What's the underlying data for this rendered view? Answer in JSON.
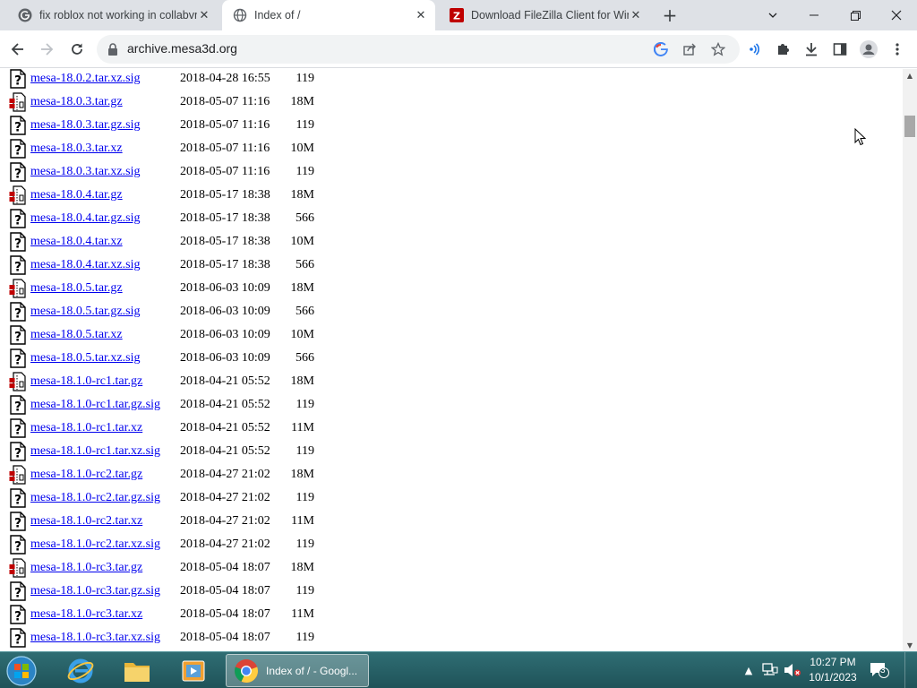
{
  "browser": {
    "tabs": [
      {
        "title": "fix roblox not working in collabvm",
        "favicon": "google-icon",
        "active": false
      },
      {
        "title": "Index of /",
        "favicon": "globe-icon",
        "active": true
      },
      {
        "title": "Download FileZilla Client for Windows",
        "favicon": "filezilla-icon",
        "active": false
      }
    ],
    "new_tab_label": "+",
    "url": "archive.mesa3d.org"
  },
  "listing": {
    "rows": [
      {
        "name": "mesa-18.0.2.tar.xz.sig",
        "date": "2018-04-28 16:55",
        "size": "119",
        "icon": "unknown-file-icon"
      },
      {
        "name": "mesa-18.0.3.tar.gz",
        "date": "2018-05-07 11:16",
        "size": "18M",
        "icon": "compressed-file-icon"
      },
      {
        "name": "mesa-18.0.3.tar.gz.sig",
        "date": "2018-05-07 11:16",
        "size": "119",
        "icon": "unknown-file-icon"
      },
      {
        "name": "mesa-18.0.3.tar.xz",
        "date": "2018-05-07 11:16",
        "size": "10M",
        "icon": "unknown-file-icon"
      },
      {
        "name": "mesa-18.0.3.tar.xz.sig",
        "date": "2018-05-07 11:16",
        "size": "119",
        "icon": "unknown-file-icon"
      },
      {
        "name": "mesa-18.0.4.tar.gz",
        "date": "2018-05-17 18:38",
        "size": "18M",
        "icon": "compressed-file-icon"
      },
      {
        "name": "mesa-18.0.4.tar.gz.sig",
        "date": "2018-05-17 18:38",
        "size": "566",
        "icon": "unknown-file-icon"
      },
      {
        "name": "mesa-18.0.4.tar.xz",
        "date": "2018-05-17 18:38",
        "size": "10M",
        "icon": "unknown-file-icon"
      },
      {
        "name": "mesa-18.0.4.tar.xz.sig",
        "date": "2018-05-17 18:38",
        "size": "566",
        "icon": "unknown-file-icon"
      },
      {
        "name": "mesa-18.0.5.tar.gz",
        "date": "2018-06-03 10:09",
        "size": "18M",
        "icon": "compressed-file-icon"
      },
      {
        "name": "mesa-18.0.5.tar.gz.sig",
        "date": "2018-06-03 10:09",
        "size": "566",
        "icon": "unknown-file-icon"
      },
      {
        "name": "mesa-18.0.5.tar.xz",
        "date": "2018-06-03 10:09",
        "size": "10M",
        "icon": "unknown-file-icon"
      },
      {
        "name": "mesa-18.0.5.tar.xz.sig",
        "date": "2018-06-03 10:09",
        "size": "566",
        "icon": "unknown-file-icon"
      },
      {
        "name": "mesa-18.1.0-rc1.tar.gz",
        "date": "2018-04-21 05:52",
        "size": "18M",
        "icon": "compressed-file-icon"
      },
      {
        "name": "mesa-18.1.0-rc1.tar.gz.sig",
        "date": "2018-04-21 05:52",
        "size": "119",
        "icon": "unknown-file-icon"
      },
      {
        "name": "mesa-18.1.0-rc1.tar.xz",
        "date": "2018-04-21 05:52",
        "size": "11M",
        "icon": "unknown-file-icon"
      },
      {
        "name": "mesa-18.1.0-rc1.tar.xz.sig",
        "date": "2018-04-21 05:52",
        "size": "119",
        "icon": "unknown-file-icon"
      },
      {
        "name": "mesa-18.1.0-rc2.tar.gz",
        "date": "2018-04-27 21:02",
        "size": "18M",
        "icon": "compressed-file-icon"
      },
      {
        "name": "mesa-18.1.0-rc2.tar.gz.sig",
        "date": "2018-04-27 21:02",
        "size": "119",
        "icon": "unknown-file-icon"
      },
      {
        "name": "mesa-18.1.0-rc2.tar.xz",
        "date": "2018-04-27 21:02",
        "size": "11M",
        "icon": "unknown-file-icon"
      },
      {
        "name": "mesa-18.1.0-rc2.tar.xz.sig",
        "date": "2018-04-27 21:02",
        "size": "119",
        "icon": "unknown-file-icon"
      },
      {
        "name": "mesa-18.1.0-rc3.tar.gz",
        "date": "2018-05-04 18:07",
        "size": "18M",
        "icon": "compressed-file-icon"
      },
      {
        "name": "mesa-18.1.0-rc3.tar.gz.sig",
        "date": "2018-05-04 18:07",
        "size": "119",
        "icon": "unknown-file-icon"
      },
      {
        "name": "mesa-18.1.0-rc3.tar.xz",
        "date": "2018-05-04 18:07",
        "size": "11M",
        "icon": "unknown-file-icon"
      },
      {
        "name": "mesa-18.1.0-rc3.tar.xz.sig",
        "date": "2018-05-04 18:07",
        "size": "119",
        "icon": "unknown-file-icon"
      }
    ]
  },
  "taskbar": {
    "active_window_label": "Index of / - Googl...",
    "clock_time": "10:27 PM",
    "clock_date": "10/1/2023",
    "notification_count": "3"
  },
  "colors": {
    "link": "#0000ee",
    "tabstrip": "#dee1e6",
    "taskbar": "#2f6d73"
  }
}
